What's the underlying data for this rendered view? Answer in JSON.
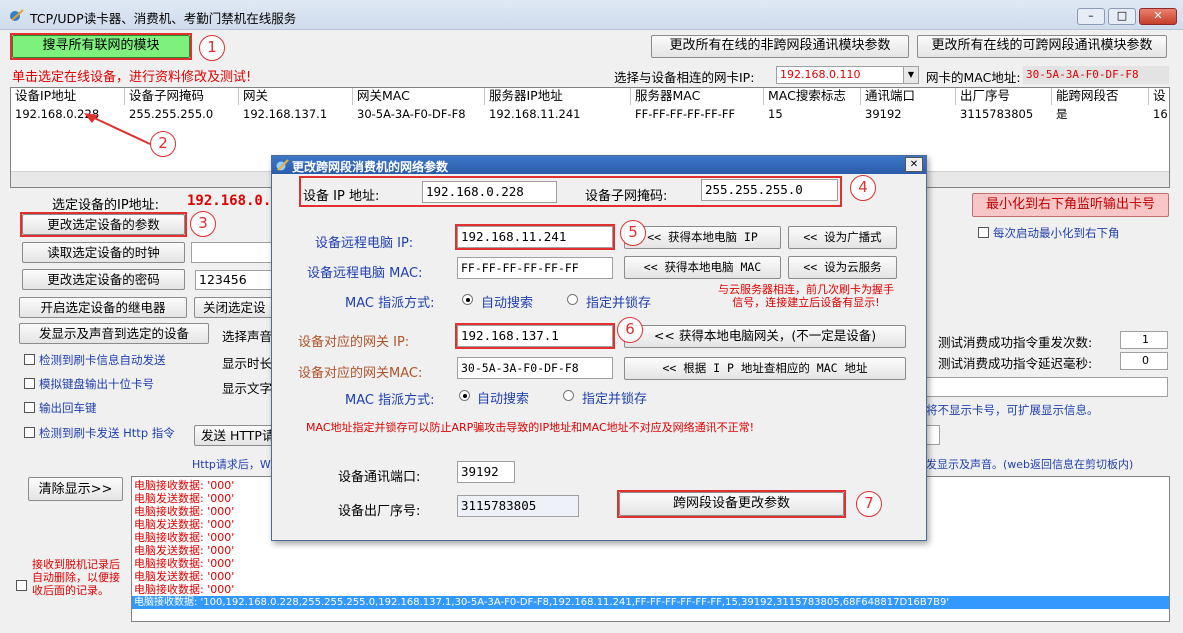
{
  "window": {
    "title": "TCP/UDP读卡器、消费机、考勤门禁机在线服务",
    "controls": {
      "minimize": "–",
      "maximize": "□",
      "close": "✕"
    }
  },
  "top": {
    "search_button": "搜寻所有联网的模块",
    "change_nonsubnet_button": "更改所有在线的非跨网段通讯模块参数",
    "change_subnet_button": "更改所有在线的可跨网段通讯模块参数",
    "hint": "单击选定在线设备，进行资料修改及测试!",
    "nic_label": "选择与设备相连的网卡IP:",
    "nic_value": "192.168.0.110",
    "mac_label": "网卡的MAC地址:",
    "mac_value": "30-5A-3A-F0-DF-F8"
  },
  "table": {
    "headers": [
      "设备IP地址",
      "设备子网掩码",
      "网关",
      "网关MAC",
      "服务器IP地址",
      "服务器MAC",
      "MAC搜索标志",
      "通讯端口",
      "出厂序号",
      "能跨网段否",
      "设"
    ],
    "row": [
      "192.168.0.228",
      "255.255.255.0",
      "192.168.137.1",
      "30-5A-3A-F0-DF-F8",
      "192.168.11.241",
      "FF-FF-FF-FF-FF-FF",
      "15",
      "39192",
      "3115783805",
      "是",
      "16"
    ]
  },
  "left": {
    "selected_ip_label": "选定设备的IP地址:",
    "selected_ip_value": "192.168.0.",
    "change_params_button": "更改选定设备的参数",
    "read_clock_button": "读取选定设备的时钟",
    "change_password_button": "更改选定设备的密码",
    "password_value": "123456",
    "open_relay_button": "开启选定设备的继电器",
    "close_relay_button": "关闭选定设",
    "send_display_button": "发显示及声音到选定的设备",
    "choose_sound_label": "选择声音",
    "show_time_label": "显示时长",
    "show_text_label": "显示文字",
    "checkboxes": [
      "检测到刷卡信息自动发送",
      "模拟键盘输出十位卡号",
      "输出回车键",
      "检测到刷卡发送 Http 指令"
    ],
    "send_http_button": "发送 HTTP请",
    "http_note_left": "Http请求后，W",
    "clear_button": "清除显示>>",
    "offline_note": "接收到脱机记录后自动删除，以便接收后面的记录。"
  },
  "right": {
    "minimize_button": "最小化到右下角监听输出卡号",
    "auto_minimize_label": "每次启动最小化到右下角",
    "retry_label": "测试消费成功指令重发次数:",
    "retry_value": "1",
    "delay_label": "测试消费成功指令延迟毫秒:",
    "delay_value": "0",
    "no_card_note": "将不显示卡号，可扩展显示信息。",
    "http_note_right": "发显示及声音。(web返回信息在剪切板内)"
  },
  "log": {
    "lines": [
      "电脑接收数据: '000'",
      "电脑发送数据: '000'",
      "电脑接收数据: '000'",
      "电脑发送数据: '000'",
      "电脑接收数据: '000'",
      "电脑发送数据: '000'",
      "电脑接收数据: '000'",
      "电脑发送数据: '000'",
      "电脑接收数据: '000'",
      "电脑发送数据: '000'",
      "电脑接收数据: '000'",
      "电脑发送数据: '000'"
    ],
    "selected_line": "电脑接收数据: '100,192.168.0.228,255.255.255.0,192.168.137.1,30-5A-3A-F0-DF-F8,192.168.11.241,FF-FF-FF-FF-FF-FF,15,39192,3115783805,68F648817D16B7B9'"
  },
  "dialog": {
    "title": "更改跨网段消费机的网络参数",
    "close": "✕",
    "ip_label": "设备 IP 地址:",
    "ip_value": "192.168.0.228",
    "mask_label": "设备子网掩码:",
    "mask_value": "255.255.255.0",
    "remote_ip_label": "设备远程电脑 IP:",
    "remote_ip_value": "192.168.11.241",
    "get_local_ip_button": "<< 获得本地电脑 IP",
    "set_broadcast_button": "<< 设为广播式",
    "remote_mac_label": "设备远程电脑 MAC:",
    "remote_mac_value": "FF-FF-FF-FF-FF-FF",
    "get_local_mac_button": "<< 获得本地电脑 MAC",
    "set_cloud_button": "<< 设为云服务",
    "mac_assign_label": "MAC 指派方式:",
    "auto_search": "自动搜索",
    "lock_specified": "指定并锁存",
    "cloud_note": "与云服务器相连，前几次刷卡为握手信号，连接建立后设备有显示!",
    "gateway_ip_label": "设备对应的网关 IP:",
    "gateway_ip_value": "192.168.137.1",
    "get_local_gateway_button": "<< 获得本地电脑网关，(不一定是设备)",
    "gateway_mac_label": "设备对应的网关MAC:",
    "gateway_mac_value": "30-5A-3A-F0-DF-F8",
    "lookup_mac_button": "<< 根据 I P 地址查相应的 MAC 地址",
    "mac_assign_label2": "MAC 指派方式:",
    "auto_search2": "自动搜索",
    "lock_specified2": "指定并锁存",
    "arp_warning": "MAC地址指定并锁存可以防止ARP骗攻击导致的IP地址和MAC地址不对应及网络通讯不正常!",
    "port_label": "设备通讯端口:",
    "port_value": "39192",
    "serial_label": "设备出厂序号:",
    "serial_value": "3115783805",
    "submit_button": "跨网段设备更改参数"
  },
  "annotations": [
    "1",
    "2",
    "3",
    "4",
    "5",
    "6",
    "7"
  ],
  "colors": {
    "accent_red": "#e03030",
    "search_green": "#7ef07e",
    "selection_blue": "#3399ff",
    "title_blue": "#2a5caa"
  }
}
